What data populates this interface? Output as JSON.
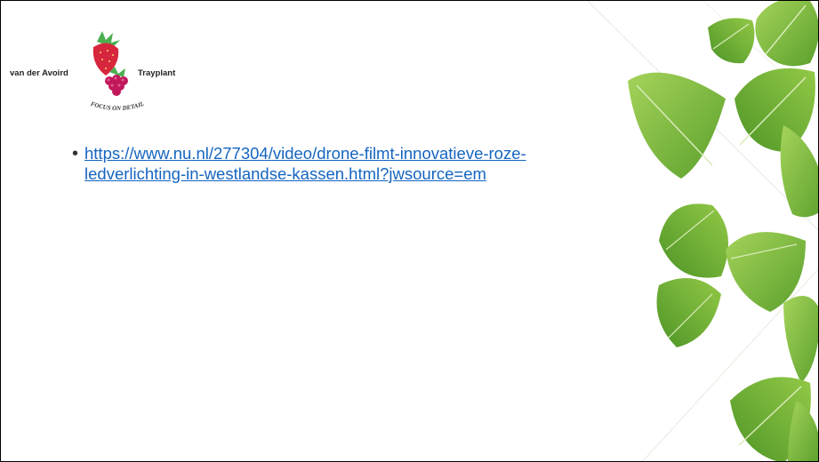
{
  "logo": {
    "left_text": "van der Avoird",
    "right_text": "Trayplant",
    "slogan": "FOCUS ON DETAIL"
  },
  "content": {
    "link_line1": "https://www.nu.nl/277304/video/drone-filmt-innovatieve-roze-",
    "link_line2": "ledverlichting-in-westlandse-kassen.html?jwsource=em"
  },
  "colors": {
    "link": "#1565c0",
    "leaf_light": "#8cc63f",
    "leaf_dark": "#5aa02c",
    "strawberry": "#d7263d",
    "raspberry": "#c2185b",
    "stem": "#4caf50"
  },
  "icons": {
    "strawberry": "strawberry-icon",
    "raspberry": "raspberry-icon",
    "leaf": "leaf-icon"
  }
}
